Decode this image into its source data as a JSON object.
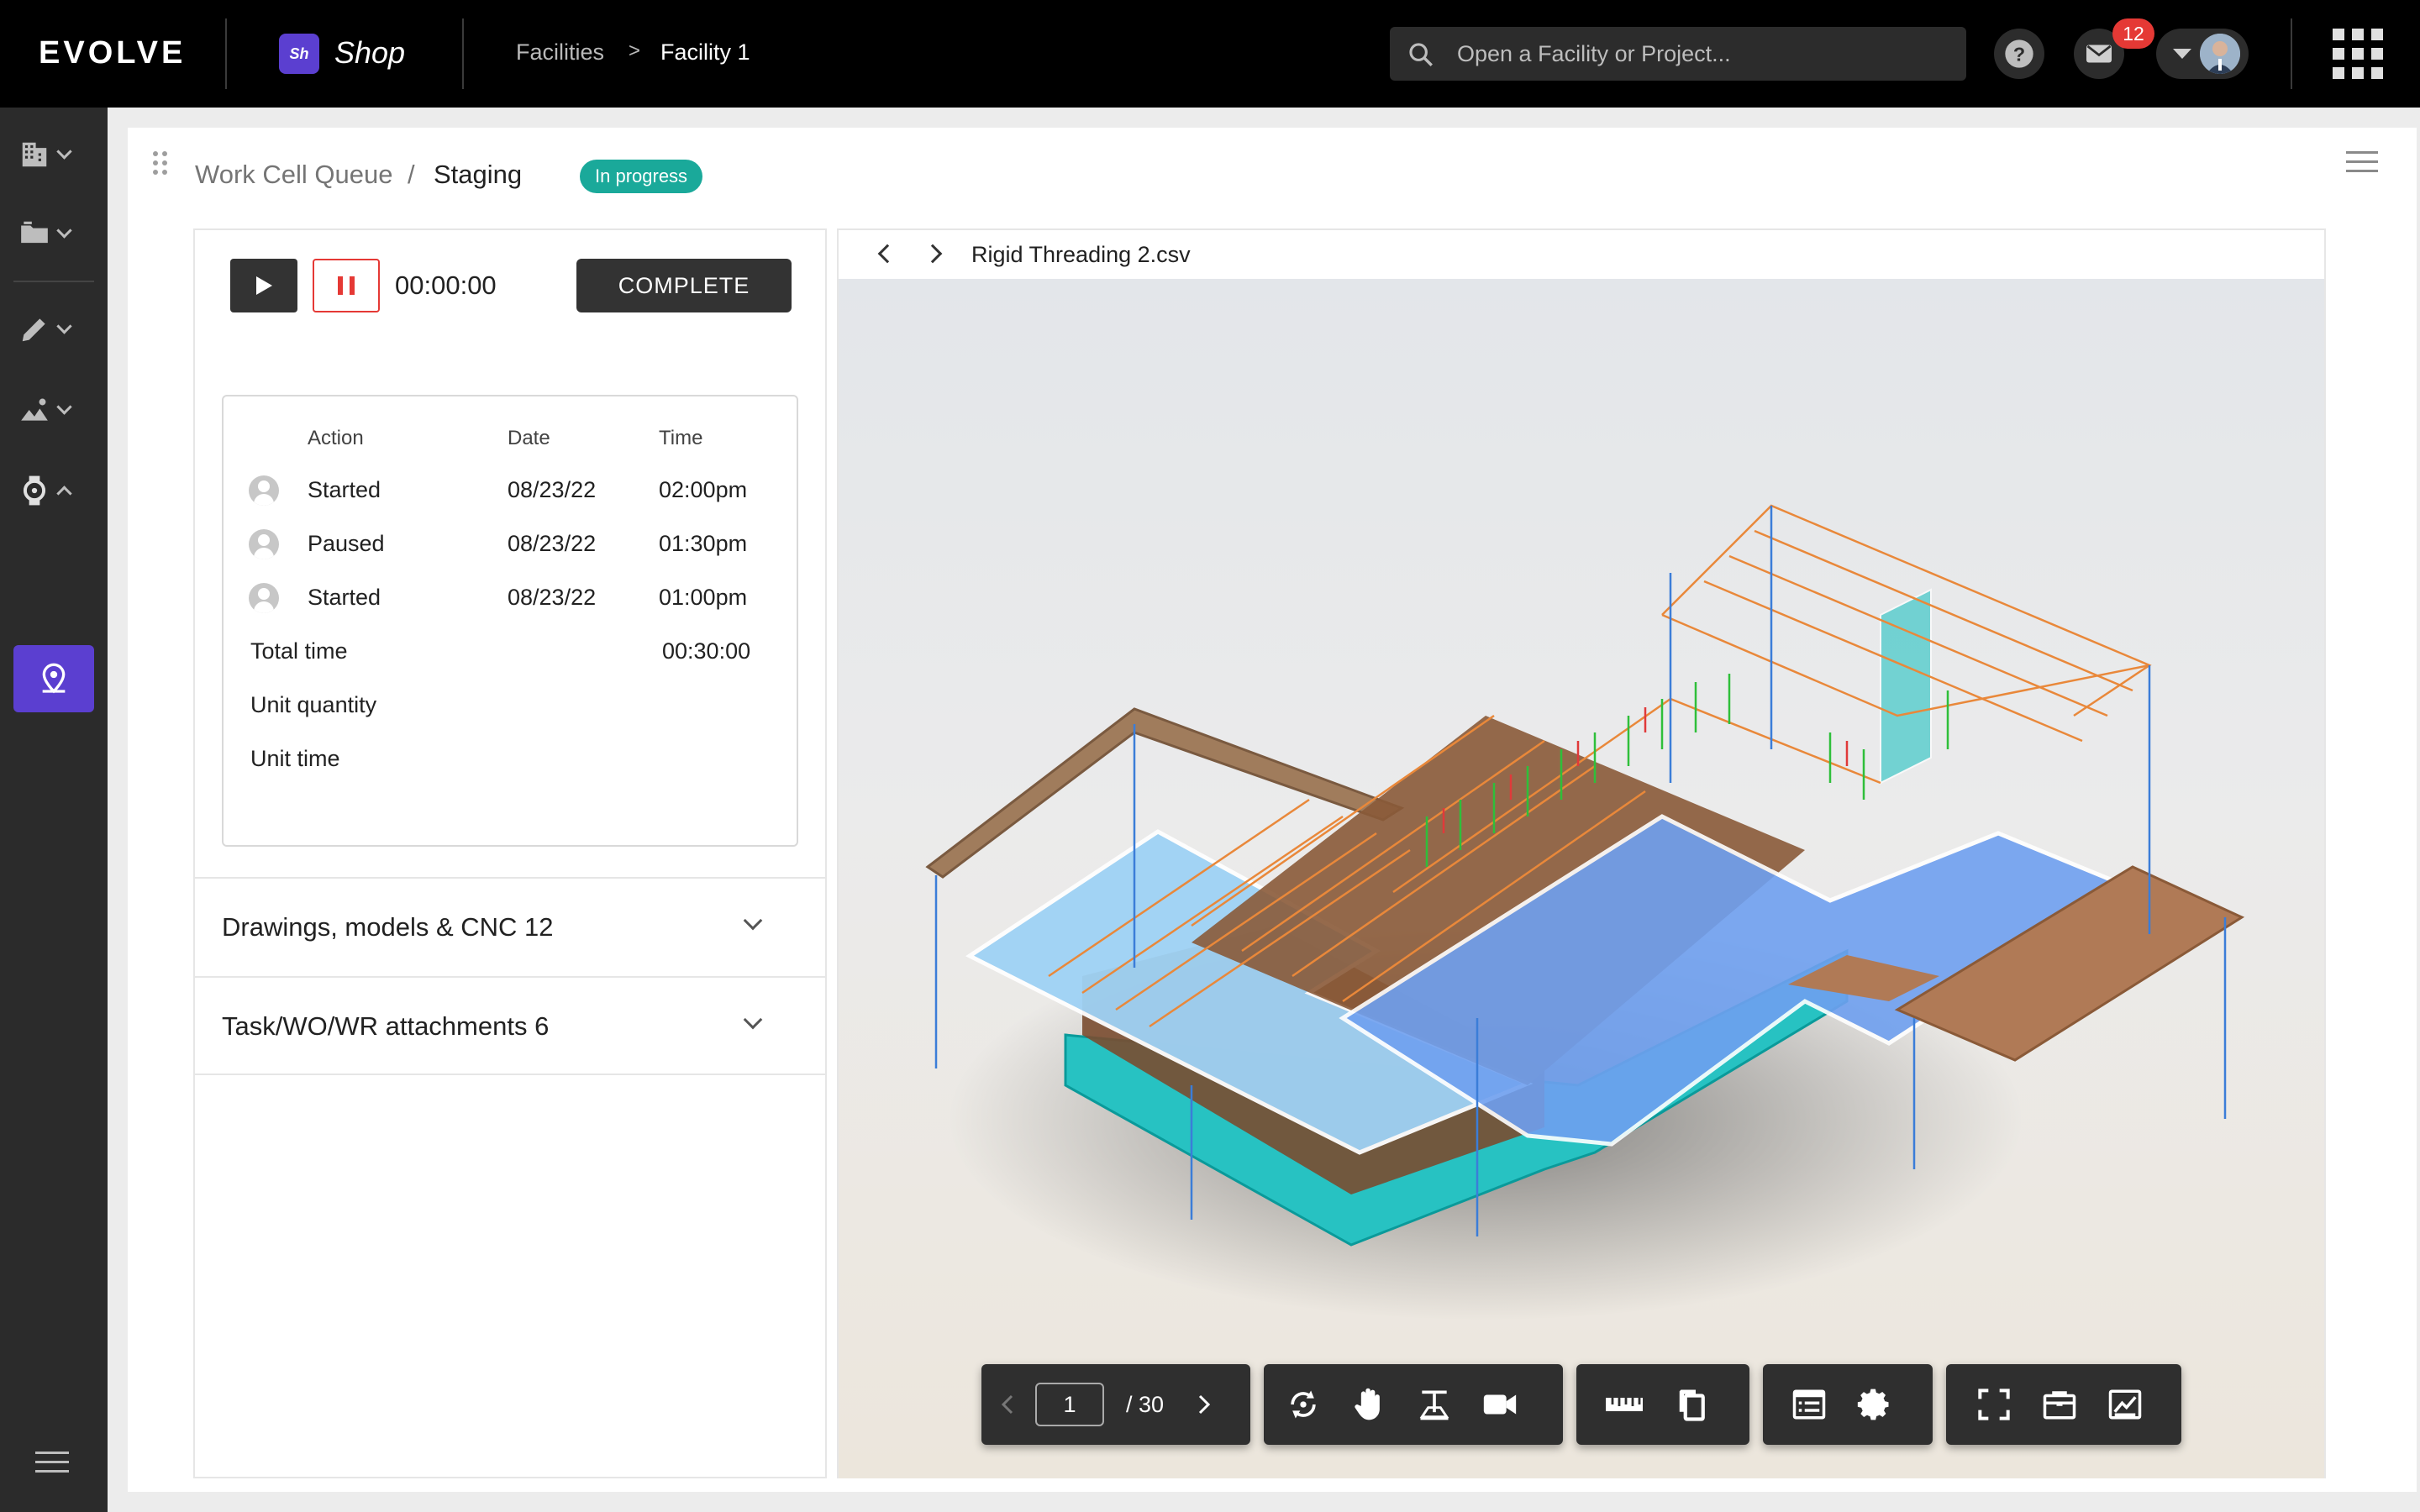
{
  "app": {
    "logo": "EVOLVE",
    "shop_badge": "Sh",
    "shop_name": "Shop",
    "breadcrumb": [
      "Facilities",
      ">",
      "Facility 1"
    ],
    "search_placeholder": "Open a Facility or Project...",
    "mail_count": "12"
  },
  "page": {
    "breadcrumb_root": "Work Cell Queue",
    "breadcrumb_sep": "/",
    "breadcrumb_current": "Staging",
    "status": "In progress"
  },
  "timer": {
    "elapsed": "00:00:00",
    "complete_label": "COMPLETE"
  },
  "log": {
    "headers": [
      "Action",
      "Date",
      "Time"
    ],
    "rows": [
      {
        "action": "Started",
        "date": "08/23/22",
        "time": "02:00pm"
      },
      {
        "action": "Paused",
        "date": "08/23/22",
        "time": "01:30pm"
      },
      {
        "action": "Started",
        "date": "08/23/22",
        "time": "01:00pm"
      }
    ],
    "total_label": "Total time",
    "total_value": "00:30:00",
    "unit_quantity_label": "Unit quantity",
    "unit_time_label": "Unit time"
  },
  "accordions": [
    {
      "label": "Drawings, models & CNC 12"
    },
    {
      "label": "Task/WO/WR attachments  6"
    }
  ],
  "viewer": {
    "file_name": "Rigid Threading 2.csv",
    "page_current": "1",
    "page_total": "/ 30"
  },
  "icons": {
    "rail": [
      "building-icon",
      "folder-icon",
      "pencil-icon",
      "chart-icon",
      "watch-icon",
      "location-icon",
      "menu-icon"
    ],
    "toolbar": [
      "prev-page-icon",
      "next-page-icon",
      "orbit-icon",
      "pan-hand-icon",
      "section-icon",
      "camera-icon",
      "ruler-icon",
      "copy-icon",
      "properties-icon",
      "settings-icon",
      "fullscreen-icon",
      "model-browser-icon",
      "explode-icon"
    ]
  },
  "colors": {
    "accent": "#5b3fd0",
    "status": "#1aa99a",
    "badge": "#e53935"
  }
}
